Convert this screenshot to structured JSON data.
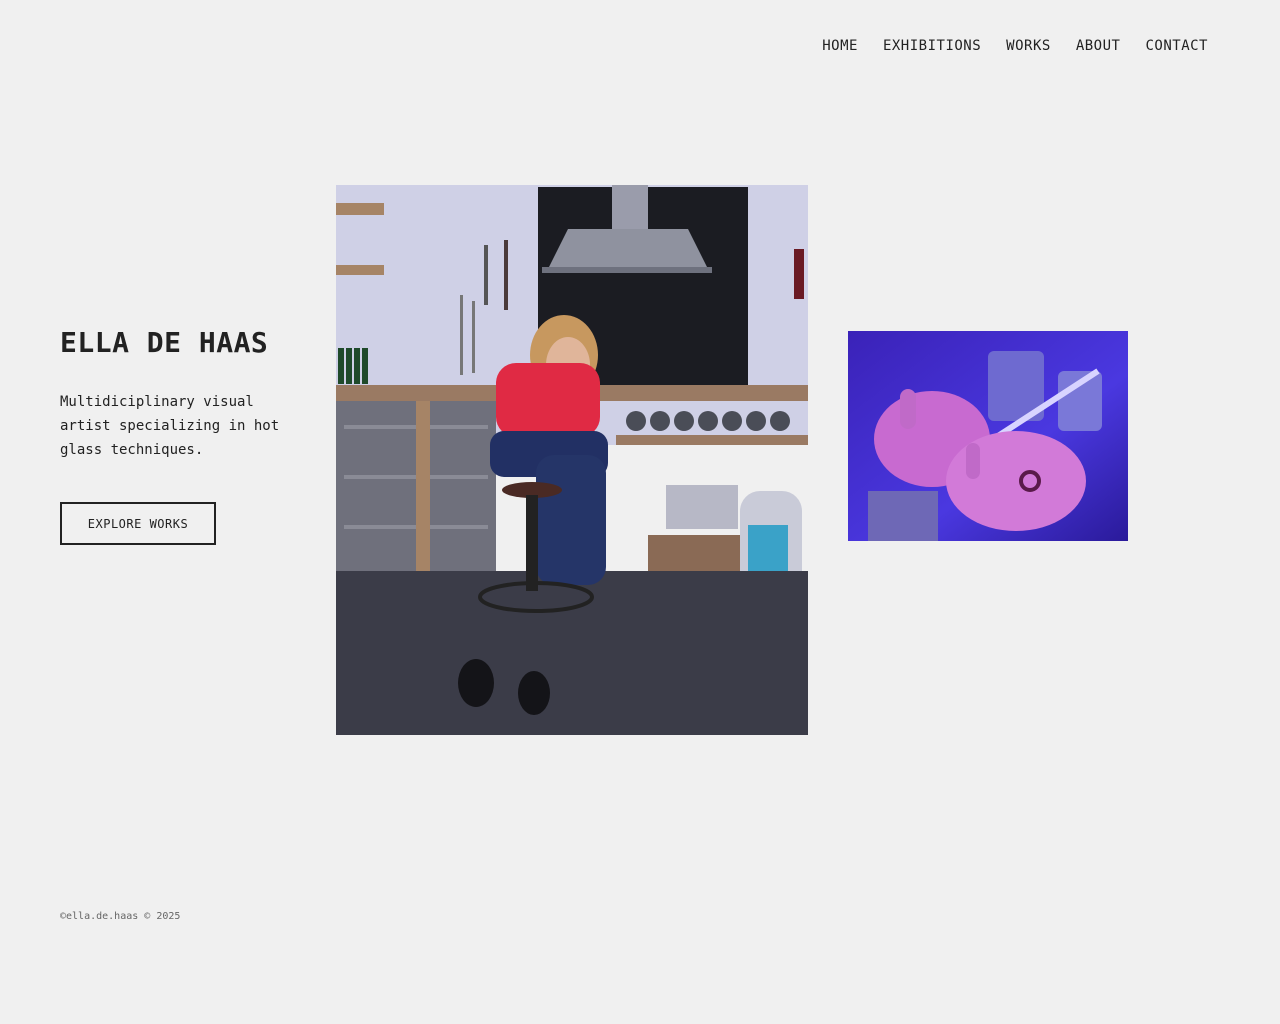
{
  "nav": {
    "items": [
      {
        "label": "HOME"
      },
      {
        "label": "EXHIBITIONS"
      },
      {
        "label": "WORKS"
      },
      {
        "label": "ABOUT"
      },
      {
        "label": "CONTACT"
      }
    ]
  },
  "hero": {
    "title": "ELLA DE HAAS",
    "description": "Multidiciplinary visual artist specializing in hot glass techniques.",
    "cta_label": "EXPLORE WORKS"
  },
  "images": {
    "main": {
      "subject": "artist-in-glass-studio-photo"
    },
    "side": {
      "subject": "hands-working-glass-torch-photo"
    }
  },
  "footer": {
    "text": "©ella.de.haas © 2025"
  },
  "colors": {
    "background": "#f0f0f0",
    "text": "#222222",
    "footer_text": "#666666"
  }
}
